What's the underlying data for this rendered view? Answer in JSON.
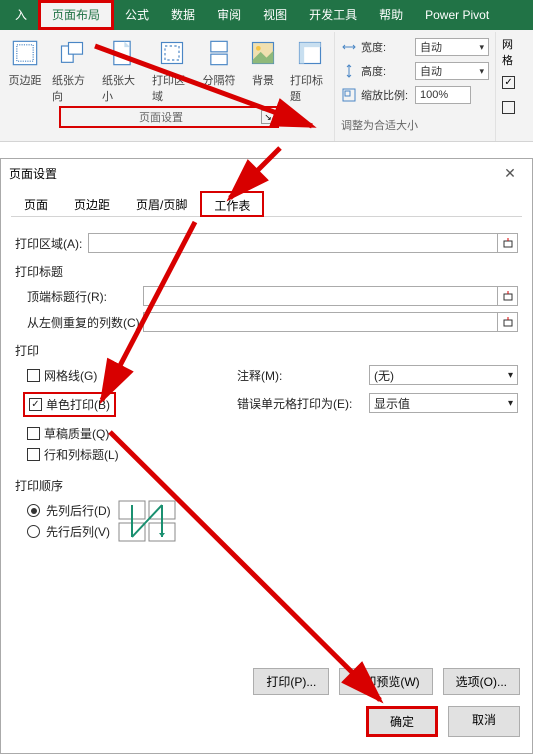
{
  "ribbon": {
    "tabs": [
      "入",
      "页面布局",
      "公式",
      "数据",
      "审阅",
      "视图",
      "开发工具",
      "帮助",
      "Power Pivot"
    ],
    "active_index": 1,
    "icons": {
      "margin": "页边距",
      "orient": "纸张方向",
      "size": "纸张大小",
      "area": "打印区域",
      "breaks": "分隔符",
      "bg": "背景",
      "titles": "打印标题"
    },
    "page_setup_label": "页面设置",
    "right": {
      "width_label": "宽度:",
      "width_value": "自动",
      "height_label": "高度:",
      "height_value": "自动",
      "scale_label": "缩放比例:",
      "scale_value": "100%",
      "fit_label": "调整为合适大小"
    },
    "gridlines_hdr": "网格"
  },
  "dialog": {
    "title": "页面设置",
    "tabs": [
      "页面",
      "页边距",
      "页眉/页脚",
      "工作表"
    ],
    "active_index": 3,
    "print_area_label": "打印区域(A):",
    "print_titles_hdr": "打印标题",
    "rows_top": "顶端标题行(R):",
    "cols_left": "从左侧重复的列数(C):",
    "print_hdr": "打印",
    "gridlines": "网格线(G)",
    "bw": "单色打印(B)",
    "draft": "草稿质量(Q)",
    "rowcol": "行和列标题(L)",
    "notes_label": "注释(M):",
    "notes_value": "(无)",
    "errors_label": "错误单元格打印为(E):",
    "errors_value": "显示值",
    "order_hdr": "打印顺序",
    "down_over": "先列后行(D)",
    "over_down": "先行后列(V)",
    "print_btn": "打印(P)...",
    "preview_btn": "打印预览(W)",
    "options_btn": "选项(O)...",
    "ok": "确定",
    "cancel": "取消"
  }
}
